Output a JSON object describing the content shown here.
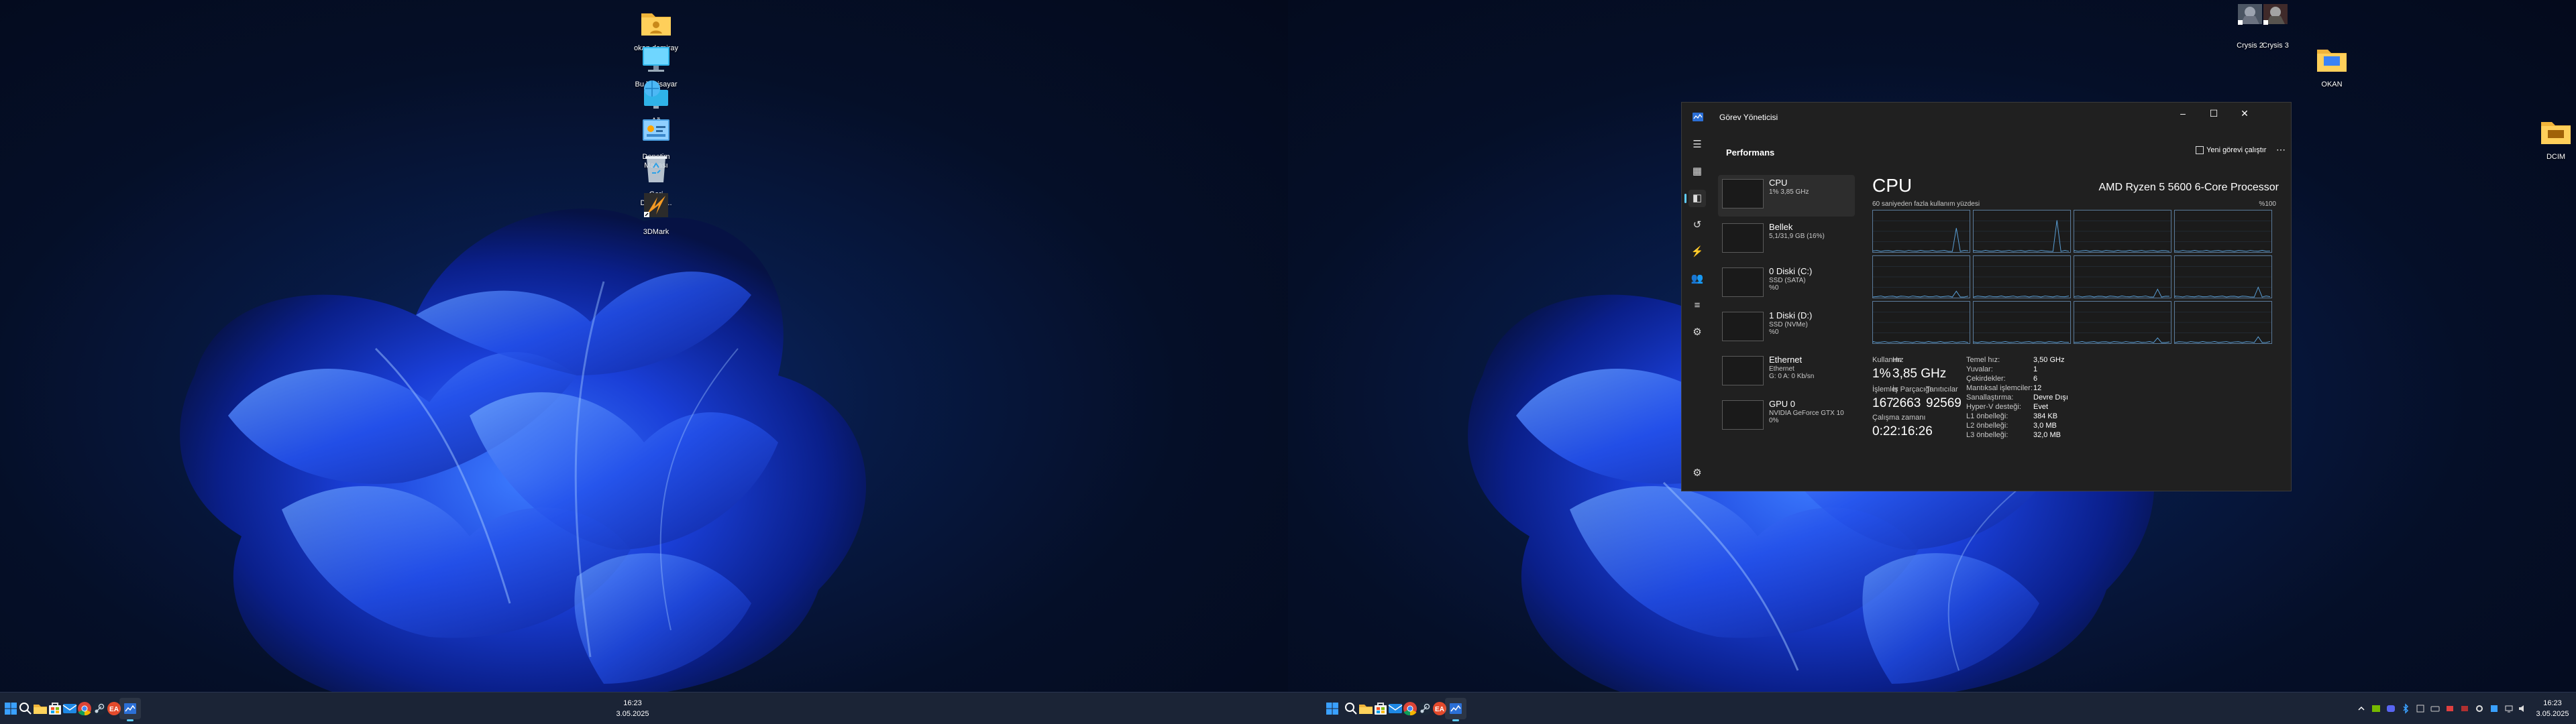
{
  "left_monitor": {
    "clock": {
      "time": "16:23",
      "date": "3.05.2025"
    }
  },
  "right_monitor": {
    "clock": {
      "time": "16:23",
      "date": "3.05.2025"
    }
  },
  "desktop_icons": {
    "user_folder": "okan demiray",
    "this_pc": "Bu bilgisayar",
    "network": "Ağ",
    "control_panel": "Denetim Masası",
    "recycle_bin": "Geri Dönüşü...",
    "threedmark": "3DMark",
    "crysis2": "Crysis 2",
    "crysis3": "Crysis 3",
    "okan_folder": "OKAN",
    "dcim_folder": "DCIM"
  },
  "task_manager": {
    "title": "Görev Yöneticisi",
    "page_title": "Performans",
    "new_task": "Yeni görevi çalıştır",
    "more": "⋯",
    "items": [
      {
        "name": "CPU",
        "sub1": "1% 3,85 GHz",
        "sub2": "",
        "sub3": ""
      },
      {
        "name": "Bellek",
        "sub1": "5,1/31,9 GB (16%)",
        "sub2": "",
        "sub3": ""
      },
      {
        "name": "0 Diski (C:)",
        "sub1": "SSD (SATA)",
        "sub2": "%0",
        "sub3": ""
      },
      {
        "name": "1 Diski (D:)",
        "sub1": "SSD (NVMe)",
        "sub2": "%0",
        "sub3": ""
      },
      {
        "name": "Ethernet",
        "sub1": "Ethernet",
        "sub2": "G: 0 A: 0 Kb/sn",
        "sub3": ""
      },
      {
        "name": "GPU 0",
        "sub1": "NVIDIA GeForce GTX 10",
        "sub2": "0%",
        "sub3": ""
      }
    ],
    "cpu": {
      "heading": "CPU",
      "model": "AMD Ryzen 5 5600 6-Core Processor",
      "graph_caption": "60 saniyeden fazla kullanım yüzdesi",
      "graph_max": "%100",
      "usage_label": "Kullanım",
      "usage_value": "1%",
      "speed_label": "Hız",
      "speed_value": "3,85 GHz",
      "processes_label": "İşlemler",
      "processes_value": "167",
      "threads_label": "İş Parçacığı",
      "threads_value": "2663",
      "handles_label": "Tanıtıcılar",
      "handles_value": "92569",
      "uptime_label": "Çalışma zamanı",
      "uptime_value": "0:22:16:26",
      "specs": [
        {
          "k": "Temel hız:",
          "v": "3,50 GHz"
        },
        {
          "k": "Yuvalar:",
          "v": "1"
        },
        {
          "k": "Çekirdekler:",
          "v": "6"
        },
        {
          "k": "Mantıksal işlemciler:",
          "v": "12"
        },
        {
          "k": "Sanallaştırma:",
          "v": "Devre Dışı"
        },
        {
          "k": "Hyper-V desteği:",
          "v": "Evet"
        },
        {
          "k": "L1 önbelleği:",
          "v": "384 KB"
        },
        {
          "k": "L2 önbelleği:",
          "v": "3,0 MB"
        },
        {
          "k": "L3 önbelleği:",
          "v": "32,0 MB"
        }
      ]
    }
  },
  "colors": {
    "accent": "#60cdff",
    "taskbar": "#1b2436",
    "tm_bg": "#202020",
    "graph_line": "#5aa0d8"
  }
}
